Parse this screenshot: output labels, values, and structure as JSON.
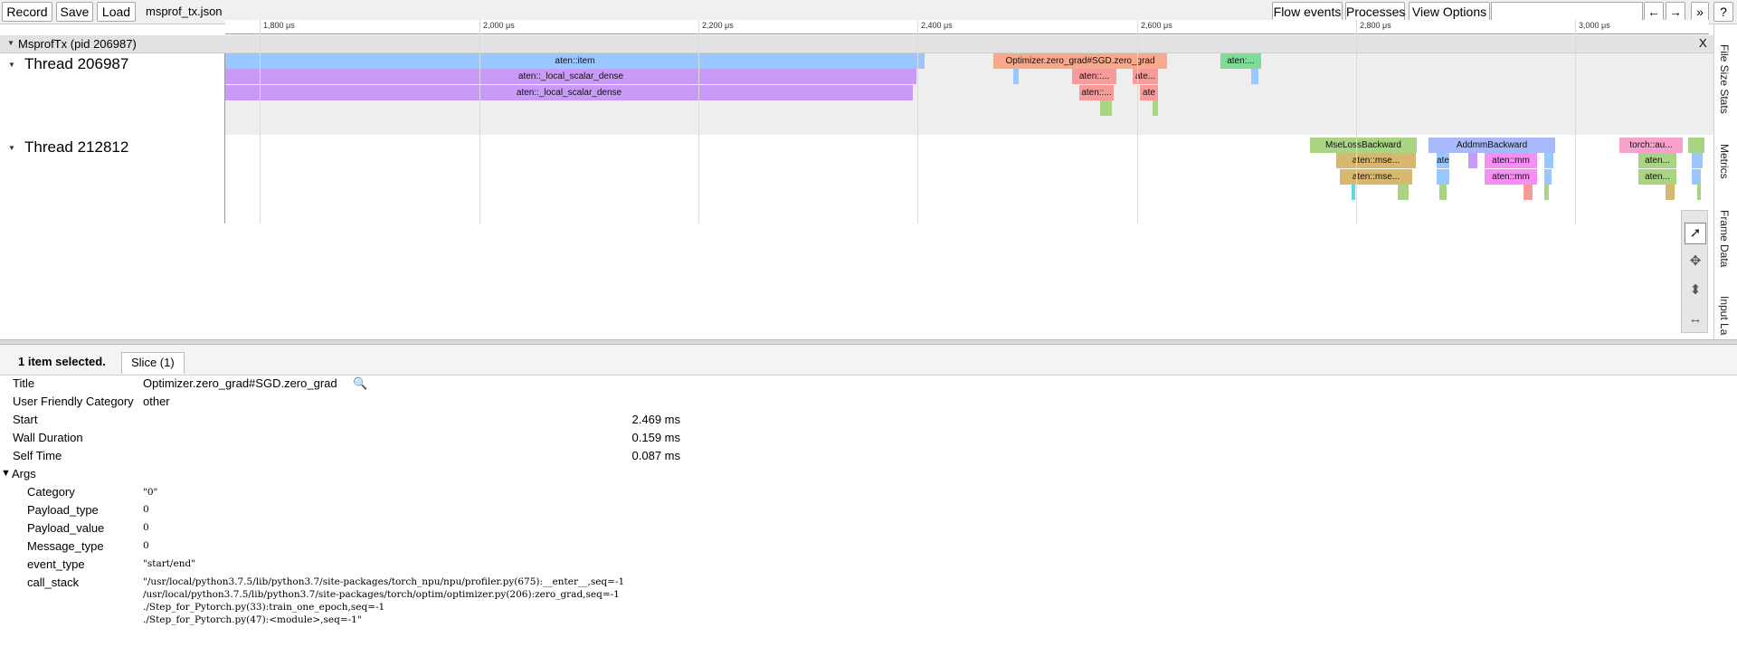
{
  "toolbar": {
    "record": "Record",
    "save": "Save",
    "load": "Load",
    "filename": "msprof_tx.json",
    "flow_events": "Flow events",
    "processes": "Processes",
    "view_options": "View Options",
    "prev": "←",
    "next": "→",
    "more": "»",
    "help": "?"
  },
  "ruler": {
    "ticks": [
      "1,800 μs",
      "2,000 μs",
      "2,200 μs",
      "2,400 μs",
      "2,600 μs",
      "2,800 μs",
      "3,000 μs"
    ]
  },
  "process": {
    "title": "MsprofTx (pid 206987)",
    "close": "X"
  },
  "threads": [
    {
      "name": "Thread 206987"
    },
    {
      "name": "Thread 212812"
    }
  ],
  "slices_thread1": [
    {
      "label": "aten::item",
      "color": "#99c7ff"
    },
    {
      "label": "aten::_local_scalar_dense",
      "color": "#c99af7"
    },
    {
      "label": "aten::_local_scalar_dense",
      "color": "#c99af7"
    },
    {
      "label": "Optimizer.zero_grad#SGD.zero_grad",
      "color": "#f7a98c"
    },
    {
      "label": "aten::...",
      "color": "#f79a9a"
    },
    {
      "label": "aten::...",
      "color": "#f79a9a"
    },
    {
      "label": "ate...",
      "color": "#f79a9a"
    },
    {
      "label": "ate",
      "color": "#f79a9a"
    },
    {
      "label": "aten:...",
      "color": "#7fdc96"
    }
  ],
  "slices_thread2": [
    {
      "label": "MseLossBackward",
      "color": "#a8d484"
    },
    {
      "label": "aten::mse...",
      "color": "#d8b86f"
    },
    {
      "label": "aten::mse...",
      "color": "#d8b86f"
    },
    {
      "label": "AddmmBackward",
      "color": "#a7b9fb"
    },
    {
      "label": "ate",
      "color": "#99c7ff"
    },
    {
      "label": "aten::mm",
      "color": "#f58ff3"
    },
    {
      "label": "aten::mm",
      "color": "#f58ff3"
    },
    {
      "label": "torch::au...",
      "color": "#f8a1cd"
    },
    {
      "label": "aten...",
      "color": "#a8d484"
    },
    {
      "label": "aten...",
      "color": "#a8d484"
    }
  ],
  "right_tabs": [
    "File Size Stats",
    "Metrics",
    "Frame Data",
    "Input La"
  ],
  "panel": {
    "selected": "1 item selected.",
    "tab": "Slice (1)",
    "rows": {
      "title_key": "Title",
      "title_val": "Optimizer.zero_grad#SGD.zero_grad",
      "category_key": "User Friendly Category",
      "category_val": "other",
      "start_key": "Start",
      "start_val": "2.469 ms",
      "wall_key": "Wall Duration",
      "wall_val": "0.159 ms",
      "self_key": "Self Time",
      "self_val": "0.087 ms",
      "args_key": "Args"
    },
    "args": [
      {
        "key": "Category",
        "val": "\"0\""
      },
      {
        "key": "Payload_type",
        "val": "0"
      },
      {
        "key": "Payload_value",
        "val": "0"
      },
      {
        "key": "Message_type",
        "val": "0"
      },
      {
        "key": "event_type",
        "val": "\"start/end\""
      }
    ],
    "call_stack_key": "call_stack",
    "call_stack": [
      "\"/usr/local/python3.7.5/lib/python3.7/site-packages/torch_npu/npu/profiler.py(675):__enter__,seq=-1",
      " /usr/local/python3.7.5/lib/python3.7/site-packages/torch/optim/optimizer.py(206):zero_grad,seq=-1",
      " ./Step_for_Pytorch.py(33):train_one_epoch,seq=-1",
      " ./Step_for_Pytorch.py(47):<module>,seq=-1\""
    ]
  }
}
